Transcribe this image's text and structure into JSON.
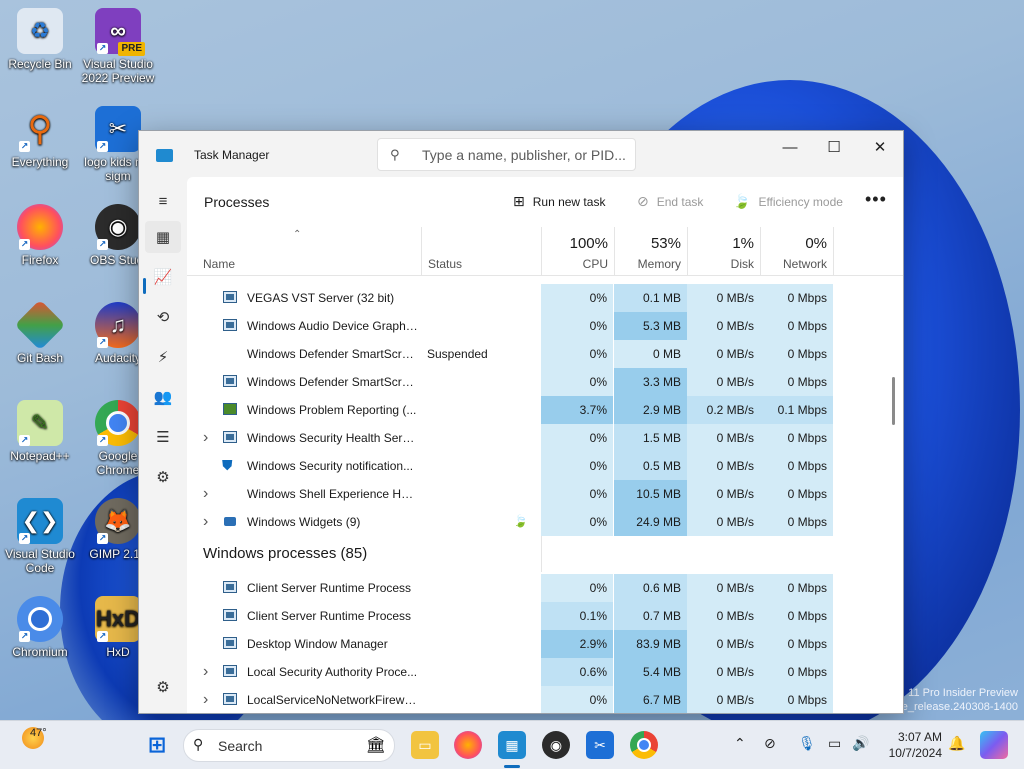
{
  "desktop": {
    "icons": [
      {
        "label": "Recycle Bin",
        "icon": "recycle-bin-icon"
      },
      {
        "label": "Visual Studio 2022 Preview",
        "icon": "visual-studio-icon",
        "badge": "PRE"
      },
      {
        "label": "Everything",
        "icon": "everything-search-icon"
      },
      {
        "label": "logo kids not sigm",
        "icon": "capcut-icon"
      },
      {
        "label": "Firefox",
        "icon": "firefox-icon"
      },
      {
        "label": "OBS Studi",
        "icon": "obs-icon"
      },
      {
        "label": "Git Bash",
        "icon": "git-icon"
      },
      {
        "label": "Audacity",
        "icon": "audacity-icon"
      },
      {
        "label": "Notepad++",
        "icon": "notepadpp-icon"
      },
      {
        "label": "Google Chrome",
        "icon": "chrome-icon"
      },
      {
        "label": "Visual Studio Code",
        "icon": "vscode-icon"
      },
      {
        "label": "GIMP 2.10",
        "icon": "gimp-icon"
      },
      {
        "label": "Chromium",
        "icon": "chromium-icon"
      },
      {
        "label": "HxD",
        "icon": "hxd-icon"
      }
    ],
    "watermark_line1": "11 Pro Insider Preview",
    "watermark_line2": "e_release.240308-1400"
  },
  "window": {
    "title": "Task Manager",
    "search_placeholder": "Type a name, publisher, or PID...",
    "controls": {
      "minimize": "—",
      "maximize": "☐",
      "close": "✕"
    }
  },
  "nav": [
    {
      "name": "hamburger-menu",
      "icon": "≡"
    },
    {
      "name": "processes",
      "icon": "▦",
      "active": true
    },
    {
      "name": "performance",
      "icon": "📈"
    },
    {
      "name": "app-history",
      "icon": "⟲"
    },
    {
      "name": "startup-apps",
      "icon": "⚡"
    },
    {
      "name": "users",
      "icon": "👥"
    },
    {
      "name": "details",
      "icon": "☰"
    },
    {
      "name": "services",
      "icon": "⚙"
    },
    {
      "name": "settings",
      "icon": "⚙"
    }
  ],
  "page": {
    "title": "Processes",
    "run_new_task": "Run new task",
    "end_task": "End task",
    "efficiency_mode": "Efficiency mode",
    "more": "•••"
  },
  "columns": {
    "name": "Name",
    "status": "Status",
    "cpu_pct": "100%",
    "cpu": "CPU",
    "mem_pct": "53%",
    "mem": "Memory",
    "disk_pct": "1%",
    "disk": "Disk",
    "net_pct": "0%",
    "net": "Network"
  },
  "rows": [
    {
      "name": "VEGAS VST Server (32 bit)",
      "status": "",
      "cpu": "0%",
      "mem": "0.1 MB",
      "disk": "0 MB/s",
      "net": "0 Mbps",
      "expand": false,
      "icon": "app"
    },
    {
      "name": "Windows Audio Device Graph ...",
      "status": "",
      "cpu": "0%",
      "mem": "5.3 MB",
      "disk": "0 MB/s",
      "net": "0 Mbps",
      "expand": false,
      "icon": "app"
    },
    {
      "name": "Windows Defender SmartScreen",
      "status": "Suspended",
      "cpu": "0%",
      "mem": "0 MB",
      "disk": "0 MB/s",
      "net": "0 Mbps",
      "expand": false,
      "icon": "none"
    },
    {
      "name": "Windows Defender SmartScreen",
      "status": "",
      "cpu": "0%",
      "mem": "3.3 MB",
      "disk": "0 MB/s",
      "net": "0 Mbps",
      "expand": false,
      "icon": "app"
    },
    {
      "name": "Windows Problem Reporting (...",
      "status": "",
      "cpu": "3.7%",
      "mem": "2.9 MB",
      "disk": "0.2 MB/s",
      "net": "0.1 Mbps",
      "expand": false,
      "icon": "report"
    },
    {
      "name": "Windows Security Health Servi...",
      "status": "",
      "cpu": "0%",
      "mem": "1.5 MB",
      "disk": "0 MB/s",
      "net": "0 Mbps",
      "expand": true,
      "icon": "app"
    },
    {
      "name": "Windows Security notification...",
      "status": "",
      "cpu": "0%",
      "mem": "0.5 MB",
      "disk": "0 MB/s",
      "net": "0 Mbps",
      "expand": false,
      "icon": "shield"
    },
    {
      "name": "Windows Shell Experience Hos...",
      "status": "",
      "cpu": "0%",
      "mem": "10.5 MB",
      "disk": "0 MB/s",
      "net": "0 Mbps",
      "expand": true,
      "icon": "none"
    },
    {
      "name": "Windows Widgets (9)",
      "status": "",
      "cpu": "0%",
      "mem": "24.9 MB",
      "disk": "0 MB/s",
      "net": "0 Mbps",
      "expand": true,
      "icon": "widgets",
      "efficiency": true
    }
  ],
  "group2": {
    "title": "Windows processes (85)"
  },
  "rows2": [
    {
      "name": "Client Server Runtime Process",
      "cpu": "0%",
      "mem": "0.6 MB",
      "disk": "0 MB/s",
      "net": "0 Mbps",
      "expand": false
    },
    {
      "name": "Client Server Runtime Process",
      "cpu": "0.1%",
      "mem": "0.7 MB",
      "disk": "0 MB/s",
      "net": "0 Mbps",
      "expand": false
    },
    {
      "name": "Desktop Window Manager",
      "cpu": "2.9%",
      "mem": "83.9 MB",
      "disk": "0 MB/s",
      "net": "0 Mbps",
      "expand": false
    },
    {
      "name": "Local Security Authority Proce...",
      "cpu": "0.6%",
      "mem": "5.4 MB",
      "disk": "0 MB/s",
      "net": "0 Mbps",
      "expand": true
    },
    {
      "name": "LocalServiceNoNetworkFirewa...",
      "cpu": "0%",
      "mem": "6.7 MB",
      "disk": "0 MB/s",
      "net": "0 Mbps",
      "expand": true
    }
  ],
  "taskbar": {
    "weather_temp": "47°",
    "search_label": "Search",
    "time": "3:07 AM",
    "date": "10/7/2024"
  }
}
